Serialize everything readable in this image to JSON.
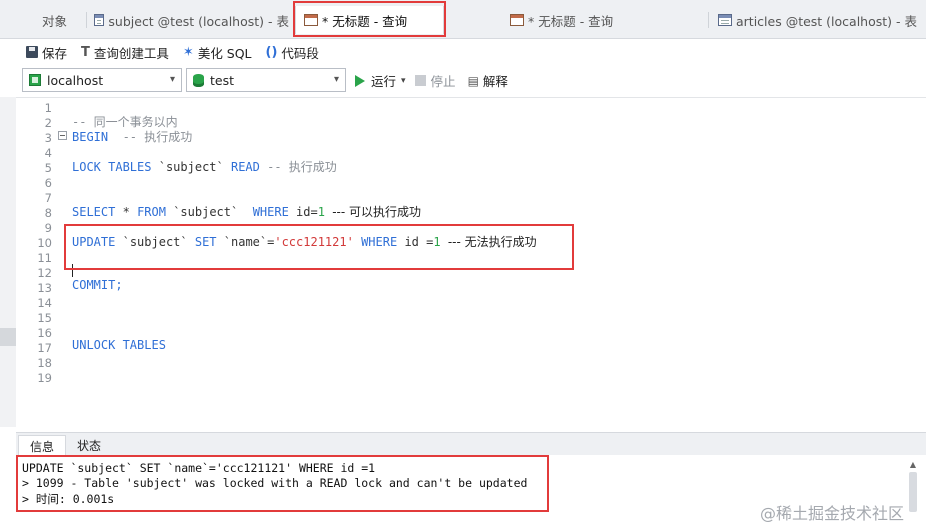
{
  "tabs": [
    {
      "label": "对象"
    },
    {
      "label": "subject @test (localhost) - 表"
    },
    {
      "label": "* 无标题 - 查询"
    },
    {
      "label": "* 无标题 - 查询"
    },
    {
      "label": "articles @test (localhost) - 表"
    }
  ],
  "toolbar": {
    "save": "保存",
    "query_builder": "查询创建工具",
    "beautify": "美化 SQL",
    "snippet_icon": "()",
    "snippet": "代码段"
  },
  "connection": {
    "host": "localhost",
    "database": "test",
    "run": "运行",
    "stop": "停止",
    "explain": "解释"
  },
  "editor": {
    "line_numbers": [
      "1",
      "2",
      "3",
      "4",
      "5",
      "6",
      "7",
      "8",
      "9",
      "10",
      "11",
      "12",
      "13",
      "14",
      "15",
      "16",
      "17",
      "18",
      "19"
    ],
    "line2": "-- 同一个事务以内",
    "line3_kw": "BEGIN",
    "line3_cm": "-- 执行成功",
    "line5_kw1": "LOCK TABLES",
    "line5_id": "`subject`",
    "line5_kw2": "READ",
    "line5_cm": "-- 执行成功",
    "line8_kw1": "SELECT",
    "line8_rest1": "*",
    "line8_kw2": "FROM",
    "line8_id": "`subject`",
    "line8_kw3": "WHERE",
    "line8_col": "id=",
    "line8_num": "1",
    "line8_cm": "--- 可以执行成功",
    "line10_kw1": "UPDATE",
    "line10_id": "`subject`",
    "line10_kw2": "SET",
    "line10_col": "`name`=",
    "line10_str": "'ccc121121'",
    "line10_kw3": "WHERE",
    "line10_col2": "id =",
    "line10_num": "1",
    "line10_cm": "--- 无法执行成功",
    "line13": "COMMIT;",
    "line17": "UNLOCK TABLES"
  },
  "panel": {
    "tab_info": "信息",
    "tab_status": "状态",
    "out1": "UPDATE `subject` SET `name`='ccc121121' WHERE id =1",
    "out2": "> 1099 - Table 'subject' was locked with a READ lock and can't be updated",
    "out3": "> 时间: 0.001s"
  },
  "watermark": "@稀土掘金技术社区",
  "colors": {
    "keyword": "#2f6fd6",
    "string": "#d23a3a",
    "number": "#2aa44a",
    "comment": "#8a8f96",
    "highlight": "#e23b3b"
  }
}
